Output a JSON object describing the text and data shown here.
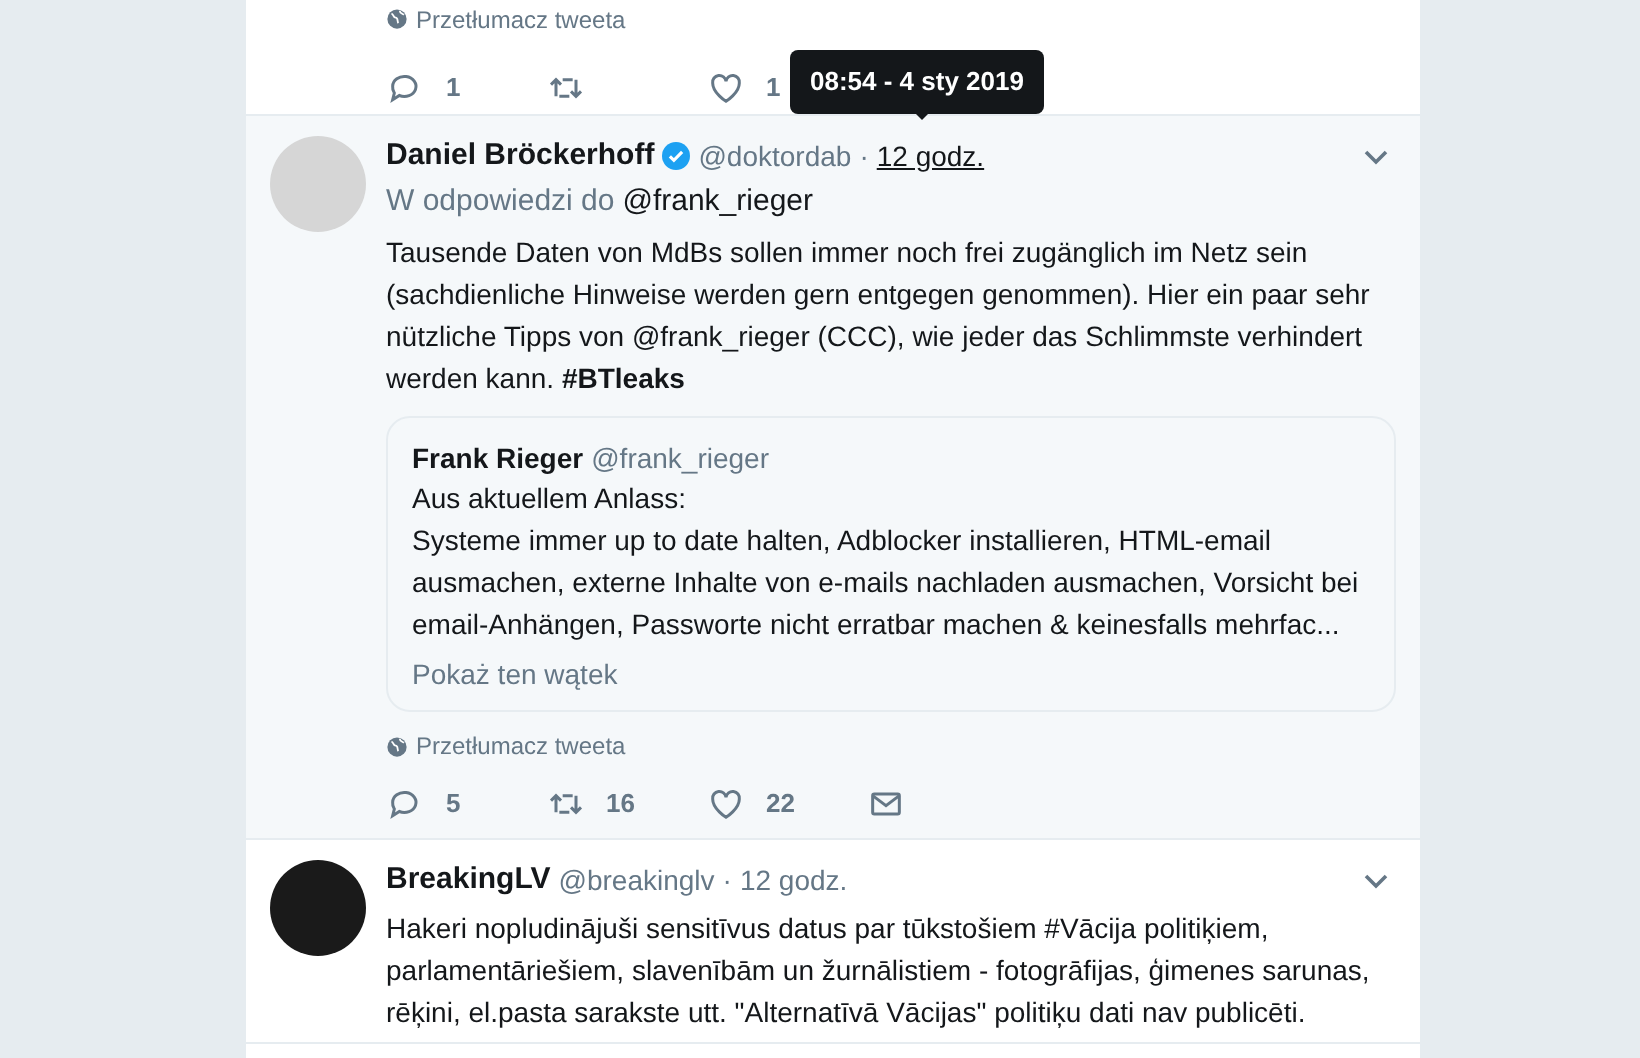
{
  "previous_tweet": {
    "translate": "Przetłumacz tweeta",
    "actions": [
      {
        "kind": "reply",
        "count": "1"
      },
      {
        "kind": "retweet"
      },
      {
        "kind": "like",
        "count": "1"
      }
    ]
  },
  "tooltip": "08:54 - 4 sty 2019",
  "tweets": [
    {
      "selected": true,
      "name": "Daniel Bröckerhoff",
      "verified": true,
      "handle": "@doktordab",
      "separator": "·",
      "time": "12 godz.",
      "reply_label": "W odpowiedzi do",
      "reply_to": "@frank_rieger",
      "text": "Tausende Daten von MdBs sollen immer noch frei zugänglich im Netz sein (sachdienliche Hinweise werden gern entgegen genommen). Hier ein paar sehr nützliche Tipps von @frank_rieger  (CCC), wie jeder das Schlimmste verhindert werden kann. **#BTleaks**",
      "quote": {
        "name": "Frank Rieger",
        "handle": "@frank_rieger",
        "lines": [
          "Aus aktuellem Anlass:",
          "Systeme immer up to date halten, Adblocker installieren, HTML-email ausmachen, externe Inhalte von e-mails nachladen ausmachen, Vorsicht bei email-Anhängen, Passworte nicht erratbar machen & keinesfalls mehrfac..."
        ],
        "thread": "Pokaż ten wątek"
      },
      "translate": "Przetłumacz tweeta",
      "actions": [
        {
          "kind": "reply",
          "count": "5"
        },
        {
          "kind": "retweet",
          "count": "16"
        },
        {
          "kind": "like",
          "count": "22"
        },
        {
          "kind": "message"
        }
      ]
    },
    {
      "selected": false,
      "name": "BreakingLV",
      "verified": false,
      "handle": "@breakinglv",
      "separator": "·",
      "time": "12 godz.",
      "text": "Hakeri nopludinājuši sensitīvus datus par tūkstošiem #Vācija politiķiem, parlamentāriešiem, slavenībām un žurnālistiem - fotogrāfijas, ģimenes sarunas, rēķini, el.pasta sarakste utt. \"Alternatīvā Vācijas\" politiķu dati nav publicēti."
    }
  ]
}
